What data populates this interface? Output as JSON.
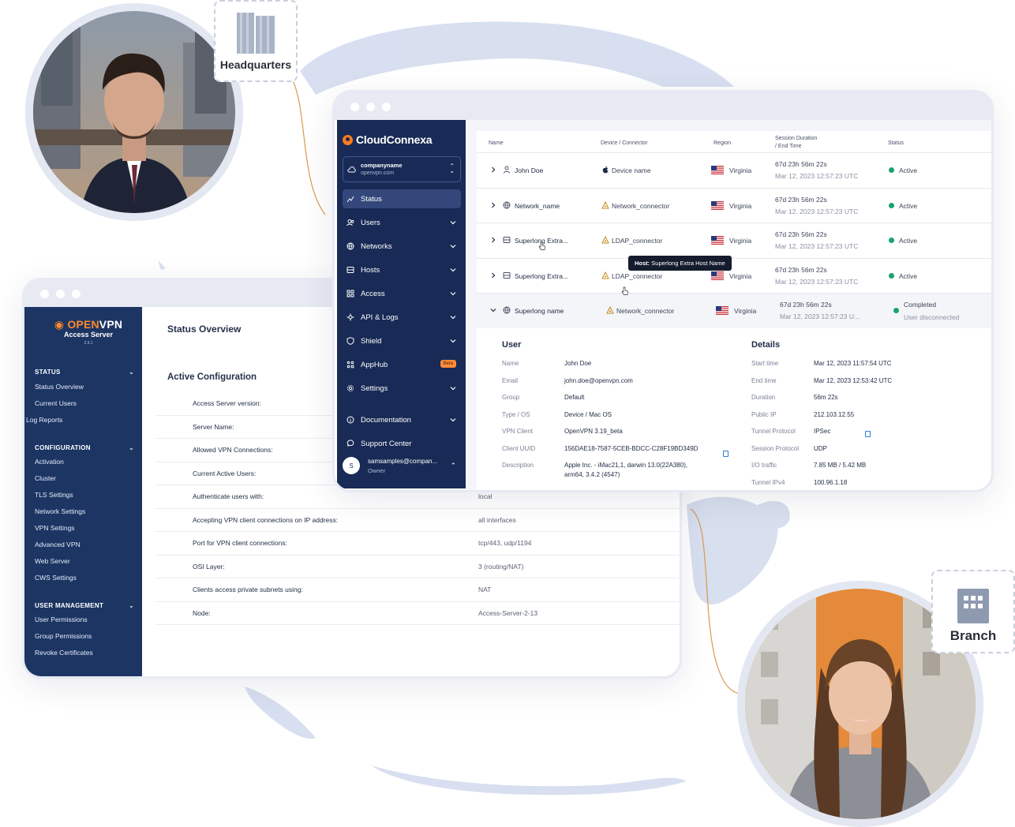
{
  "locations": {
    "headquarters": "Headquarters",
    "branch": "Branch"
  },
  "colors": {
    "sidebar_as": "#1c3563",
    "sidebar_cc": "#182a55",
    "accent": "#ff8a2b",
    "active_status": "#1aa36b",
    "globe": "#d4dcee",
    "connector_line": "#d99a4e"
  },
  "access_server": {
    "logo": {
      "brand_a": "OPEN",
      "brand_b": "VPN",
      "product": "Access Server",
      "version": "2.9.1"
    },
    "sidebar": {
      "sections": [
        {
          "title": "STATUS",
          "items": [
            "Status Overview",
            "Current Users",
            "Log Reports"
          ]
        },
        {
          "title": "CONFIGURATION",
          "items": [
            "Activation",
            "Cluster",
            "TLS Settings",
            "Network Settings",
            "VPN Settings",
            "Advanced VPN",
            "Web Server",
            "CWS Settings"
          ]
        },
        {
          "title": "USER MANAGEMENT",
          "items": [
            "User Permissions",
            "Group Permissions",
            "Revoke Certificates"
          ]
        }
      ]
    },
    "page_title": "Status Overview",
    "section_title": "Active Configuration",
    "config_rows": [
      {
        "key": "Access Server version:",
        "value": ""
      },
      {
        "key": "Server Name:",
        "value": ""
      },
      {
        "key": "Allowed VPN Connections:",
        "value": ""
      },
      {
        "key": "Current Active Users:",
        "value": ""
      },
      {
        "key": "Authenticate users with:",
        "value": "local"
      },
      {
        "key": "Accepting VPN client connections on IP address:",
        "value": "all interfaces"
      },
      {
        "key": "Port for VPN client connections:",
        "value": "tcp/443, udp/1194"
      },
      {
        "key": "OSI Layer:",
        "value": "3 (routing/NAT)"
      },
      {
        "key": "Clients access private subnets using:",
        "value": "NAT"
      },
      {
        "key": "Node:",
        "value": "Access-Server-2-13"
      }
    ]
  },
  "cloudconnexa": {
    "logo": "CloudConnexa",
    "org": {
      "name": "companyname",
      "domain": "openvpn.com"
    },
    "nav": [
      {
        "label": "Status",
        "icon": "chart-icon",
        "active": true
      },
      {
        "label": "Users",
        "icon": "users-icon"
      },
      {
        "label": "Networks",
        "icon": "globe-icon"
      },
      {
        "label": "Hosts",
        "icon": "server-icon"
      },
      {
        "label": "Access",
        "icon": "grid-icon"
      },
      {
        "label": "API & Logs",
        "icon": "api-icon"
      },
      {
        "label": "Shield",
        "icon": "shield-icon"
      },
      {
        "label": "AppHub",
        "icon": "apps-icon",
        "badge": "Beta"
      },
      {
        "label": "Settings",
        "icon": "gear-icon"
      },
      {
        "label": "Documentation",
        "icon": "doc-icon"
      },
      {
        "label": "Support Center",
        "icon": "chat-icon"
      }
    ],
    "user": {
      "initial": "S",
      "email": "samsamples@compan...",
      "role": "Owner"
    },
    "table": {
      "headers": {
        "name": "Name",
        "device": "Device / Connector",
        "region": "Region",
        "session_a": "Session Duration",
        "session_b": "/ End Time",
        "status": "Status"
      },
      "rows": [
        {
          "name": "John Doe",
          "device": "Device name",
          "region": "Virginia",
          "duration": "67d 23h 56m 22s",
          "end": "Mar 12, 2023 12:57:23 UTC",
          "status": "Active"
        },
        {
          "name": "Network_name",
          "device": "Network_connector",
          "region": "Virginia",
          "duration": "67d 23h 56m 22s",
          "end": "Mar 12, 2023 12:57:23 UTC",
          "status": "Active"
        },
        {
          "name": "Superlong Extra...",
          "device": "LDAP_connector",
          "region": "Virginia",
          "duration": "67d 23h 56m 22s",
          "end": "Mar 12, 2023 12:57:23 UTC",
          "status": "Active"
        },
        {
          "name": "Superlong Extra...",
          "device": "LDAP_connector",
          "region": "Virginia",
          "duration": "67d 23h 56m 22s",
          "end": "Mar 12, 2023 12:57:23 UTC",
          "status": "Active"
        },
        {
          "name": "Superlong name",
          "device": "Network_connector",
          "region": "Virginia",
          "duration": "67d 23h 56m 22s",
          "end": "Mar 12, 2023 12:57:23 U...",
          "status": "Completed",
          "status2": "User disconnected"
        }
      ]
    },
    "tooltip": {
      "label": "Host:",
      "value": "Superlong Extra Host Name"
    },
    "details": {
      "user_title": "User",
      "user": [
        {
          "key": "Name",
          "value": "John Doe"
        },
        {
          "key": "Email",
          "value": "john.doe@openvpn.com"
        },
        {
          "key": "Group",
          "value": "Default"
        },
        {
          "key": "Type / OS",
          "value": "Device / Mac OS"
        },
        {
          "key": "VPN Client",
          "value": "OpenVPN 3.19_beta"
        },
        {
          "key": "Client UUID",
          "value": "156DAE18-7587-5CEB-BDCC-C28F19BD349D"
        },
        {
          "key": "Description",
          "value": "Apple Inc. - iMac21,1, darwin 13.0(22A380),",
          "value2": "arm64, 3.4.2 (4547)"
        }
      ],
      "details_title": "Details",
      "details": [
        {
          "key": "Start time",
          "value": "Mar 12, 2023 11:57:54 UTC"
        },
        {
          "key": "End time",
          "value": "Mar 12, 2023 12:53:42 UTC"
        },
        {
          "key": "Duration",
          "value": "56m 22s"
        },
        {
          "key": "Public IP",
          "value": "212.103.12.55"
        },
        {
          "key": "Tunnel Protocol",
          "value": "IPSec"
        },
        {
          "key": "Session Protocol",
          "value": "UDP"
        },
        {
          "key": "I/O traffic",
          "value": "7.85 MB / 5.42 MB"
        },
        {
          "key": "Tunnel IPv4",
          "value": "100.96.1.18"
        }
      ]
    }
  }
}
